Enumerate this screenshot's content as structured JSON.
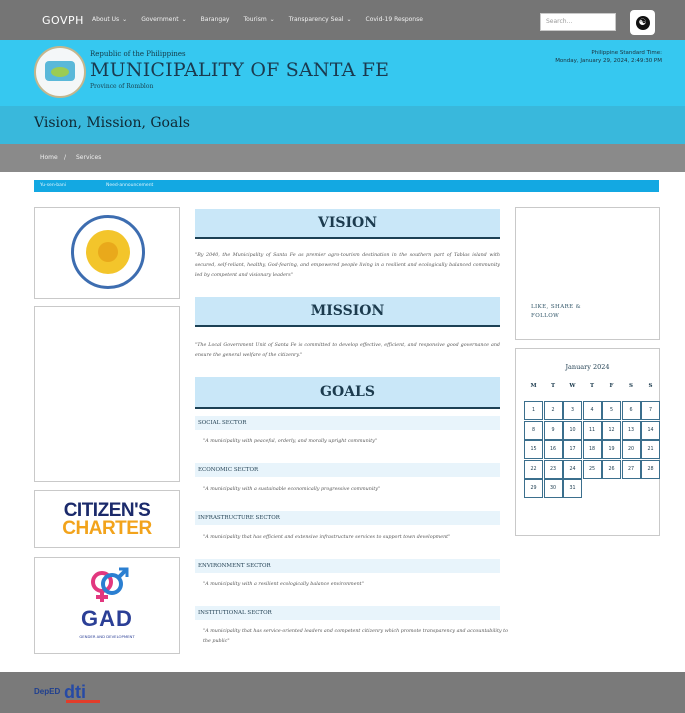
{
  "topbar": {
    "brand": "GOVPH",
    "nav": [
      "About Us",
      "Government",
      "Barangay",
      "Tourism",
      "Transparency Seal",
      "Covid-19 Response"
    ],
    "nav_dropdown": [
      true,
      true,
      false,
      true,
      true,
      false
    ],
    "search_placeholder": "Search..."
  },
  "masthead": {
    "republic": "Republic of the Philippines",
    "municipality": "MUNICIPALITY OF SANTA FE",
    "province": "Province of Romblon",
    "time_label": "Philippine Standard Time:",
    "datetime": "Monday, January 29, 2024, 2:49:30 PM"
  },
  "page": {
    "title": "Vision, Mission, Goals",
    "breadcrumb": [
      "Home",
      "Services"
    ],
    "ticker": [
      "Yu-sen-bani",
      "Need-announcement"
    ]
  },
  "sidebar_left": {
    "charter_line1": "CITIZEN'S",
    "charter_line2": "CHARTER",
    "gad_title": "GAD",
    "gad_sub": "GENDER AND DEVELOPMENT"
  },
  "content": {
    "vision_title": "VISION",
    "vision_text": "\"By 2040, the Municipality of Santa Fe as premier agro-tourism destination in the southern part of Tablas island with secured, self-reliant, healthy, God-fearing, and empowered people living in a resilient and ecologically balanced community led by competent and visionary leaders\"",
    "mission_title": "MISSION",
    "mission_text": "\"The Local Government Unit of Santa Fe is committed to develop effective, efficient, and responsive good governance and ensure the general welfare of the citizenry.\"",
    "goals_title": "GOALS",
    "goals": [
      {
        "sector": "SOCIAL SECTOR",
        "text": "\"A municipality with peaceful, orderly, and morally upright community\""
      },
      {
        "sector": "ECONOMIC SECTOR",
        "text": "\"A municipality with a sustainable economically progressive community\""
      },
      {
        "sector": "INFRASTRUCTURE SECTOR",
        "text": "\"A municipality that has efficient and extensive infrastructure services to support town development\""
      },
      {
        "sector": "ENVIRONMENT SECTOR",
        "text": "\"A municipality with a resilient ecologically balance environment\""
      },
      {
        "sector": "INSTITUTIONAL SECTOR",
        "text": "\"A municipality that has service-oriented leaders and competent citizenry which promote transparency and accountability to the public\""
      }
    ]
  },
  "sidebar_right": {
    "social": "LIKE, SHARE & FOLLOW",
    "calendar_title": "January 2024",
    "weekdays": [
      "M",
      "T",
      "W",
      "T",
      "F",
      "S",
      "S"
    ],
    "days": [
      "1",
      "2",
      "3",
      "4",
      "5",
      "6",
      "7",
      "8",
      "9",
      "10",
      "11",
      "12",
      "13",
      "14",
      "15",
      "16",
      "17",
      "18",
      "19",
      "20",
      "21",
      "22",
      "23",
      "24",
      "25",
      "26",
      "27",
      "28",
      "29",
      "30",
      "31"
    ]
  },
  "footer": {
    "logo1": "DepED",
    "logo2": "dti"
  },
  "colors": {
    "masthead": "#36c8f0",
    "titlebar": "#39b8dc",
    "topbar": "#757575",
    "charter_blue": "#1b2a6b",
    "charter_orange": "#f2a31b"
  }
}
